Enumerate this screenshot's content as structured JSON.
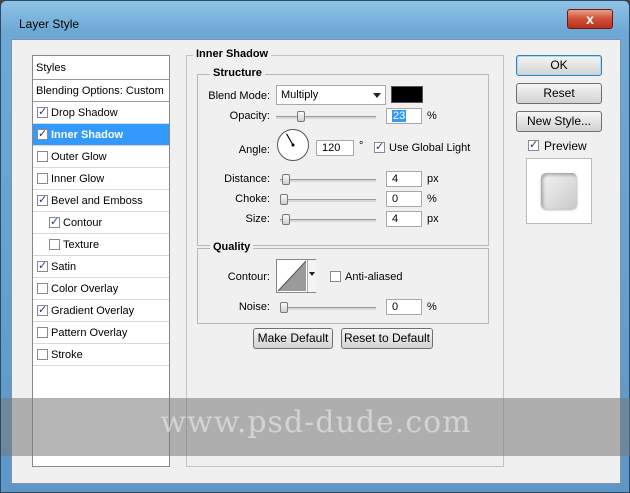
{
  "window": {
    "title": "Layer Style",
    "close_symbol": "x"
  },
  "styles_list": {
    "header": "Styles",
    "blending": "Blending Options: Custom",
    "items": [
      {
        "label": "Drop Shadow",
        "checked": true,
        "selected": false,
        "indent": false
      },
      {
        "label": "Inner Shadow",
        "checked": true,
        "selected": true,
        "indent": false
      },
      {
        "label": "Outer Glow",
        "checked": false,
        "selected": false,
        "indent": false
      },
      {
        "label": "Inner Glow",
        "checked": false,
        "selected": false,
        "indent": false
      },
      {
        "label": "Bevel and Emboss",
        "checked": true,
        "selected": false,
        "indent": false
      },
      {
        "label": "Contour",
        "checked": true,
        "selected": false,
        "indent": true
      },
      {
        "label": "Texture",
        "checked": false,
        "selected": false,
        "indent": true
      },
      {
        "label": "Satin",
        "checked": true,
        "selected": false,
        "indent": false
      },
      {
        "label": "Color Overlay",
        "checked": false,
        "selected": false,
        "indent": false
      },
      {
        "label": "Gradient Overlay",
        "checked": true,
        "selected": false,
        "indent": false
      },
      {
        "label": "Pattern Overlay",
        "checked": false,
        "selected": false,
        "indent": false
      },
      {
        "label": "Stroke",
        "checked": false,
        "selected": false,
        "indent": false
      }
    ]
  },
  "inner_shadow": {
    "title": "Inner Shadow",
    "structure": {
      "title": "Structure",
      "blend_mode_label": "Blend Mode:",
      "blend_mode_value": "Multiply",
      "shadow_color": "#000000",
      "opacity_label": "Opacity:",
      "opacity_value": "23",
      "opacity_unit": "%",
      "opacity_fraction": 0.23,
      "angle_label": "Angle:",
      "angle_value": "120",
      "angle_deg": 120,
      "angle_unit": "°",
      "global_light_label": "Use Global Light",
      "global_light_checked": true,
      "distance_label": "Distance:",
      "distance_value": "4",
      "distance_fraction": 0.02,
      "distance_unit": "px",
      "choke_label": "Choke:",
      "choke_value": "0",
      "choke_fraction": 0.0,
      "choke_unit": "%",
      "size_label": "Size:",
      "size_value": "4",
      "size_fraction": 0.02,
      "size_unit": "px"
    },
    "quality": {
      "title": "Quality",
      "contour_label": "Contour:",
      "anti_aliased_label": "Anti-aliased",
      "anti_aliased_checked": false,
      "noise_label": "Noise:",
      "noise_value": "0",
      "noise_fraction": 0.0,
      "noise_unit": "%"
    },
    "make_default": "Make Default",
    "reset_default": "Reset to Default"
  },
  "actions": {
    "ok": "OK",
    "reset": "Reset",
    "new_style": "New Style...",
    "preview_label": "Preview",
    "preview_checked": true
  },
  "watermark": "www.psd-dude.com",
  "colors": {
    "accent": "#3399ff",
    "frame": "#6ea9d6",
    "close": "#c8402a"
  }
}
